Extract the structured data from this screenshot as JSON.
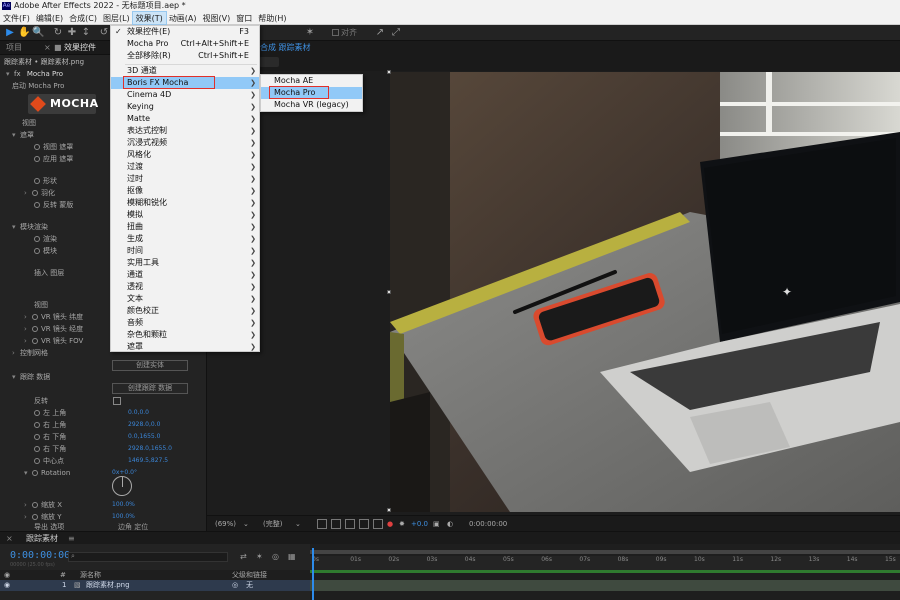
{
  "app": {
    "title": "Adobe After Effects 2022 - 无标题项目.aep *",
    "logo_text": "Ae"
  },
  "menubar": [
    "文件(F)",
    "编辑(E)",
    "合成(C)",
    "图层(L)",
    "效果(T)",
    "动画(A)",
    "视图(V)",
    "窗口",
    "帮助(H)"
  ],
  "toolbar": {
    "snap_label": "对齐"
  },
  "left_panel": {
    "tabs": [
      "项目",
      "效果控件"
    ],
    "crumb": "跟踪素材 • 跟踪素材.png",
    "effect_name": "Mocha Pro",
    "mocha_logo_text": "MOCHA",
    "rows": [
      {
        "label": "启动  Mocha Pro",
        "indent": 1
      },
      {
        "label": "视图",
        "indent": 1
      },
      {
        "label": "遮罩",
        "indent": 1
      },
      {
        "label": "视图 遮罩",
        "indent": 3
      },
      {
        "label": "应用 遮罩",
        "indent": 3
      },
      {
        "label": "形状",
        "indent": 3
      },
      {
        "label": "羽化",
        "indent": 3
      },
      {
        "label": "反转 蒙版",
        "indent": 3
      },
      {
        "label": "模块渲染",
        "indent": 1
      },
      {
        "label": "渲染",
        "indent": 3
      },
      {
        "label": "模块",
        "indent": 3
      },
      {
        "label": "插入 图层",
        "indent": 2
      },
      {
        "label": "视图",
        "indent": 2
      },
      {
        "label": "VR 镜头 纬度",
        "indent": 3
      },
      {
        "label": "VR 镜头 经度",
        "indent": 3
      },
      {
        "label": "VR 镜头 FOV",
        "indent": 3
      },
      {
        "label": "控制网格",
        "indent": 1
      },
      {
        "label": "跟踪 数据",
        "indent": 1
      },
      {
        "label": "反转",
        "indent": 2
      },
      {
        "label": "左 上角",
        "indent": 3
      },
      {
        "label": "右 上角",
        "indent": 3
      },
      {
        "label": "右 下角",
        "indent": 3
      },
      {
        "label": "右 下角",
        "indent": 3
      },
      {
        "label": "中心点",
        "indent": 3
      },
      {
        "label": "Rotation",
        "indent": 3
      },
      {
        "label": "缩放 X",
        "indent": 3
      },
      {
        "label": "缩放 Y",
        "indent": 3
      },
      {
        "label": "导出 选项",
        "indent": 2
      }
    ],
    "buttons": {
      "create_solid": "创建实体",
      "create_track": "创建跟踪 数据"
    },
    "values": [
      "0.0,0.0",
      "2928.0,0.0",
      "0.0,1655.0",
      "2928.0,1655.0",
      "1469.5,827.5",
      "0x+0.0°",
      "100.0%",
      "100.0%"
    ],
    "export_value": "边角 定位"
  },
  "comp": {
    "tab": "合成 跟踪素材",
    "zoom": "(69%)",
    "quality": "(完整)",
    "exposure": "+0.0",
    "timecode": "0:00:00:00"
  },
  "effects_menu": {
    "items": [
      {
        "label": "效果控件(E)",
        "shortcut": "F3",
        "checked": true
      },
      {
        "label": "Mocha Pro",
        "shortcut": "Ctrl+Alt+Shift+E"
      },
      {
        "label": "全部移除(R)",
        "shortcut": "Ctrl+Shift+E"
      },
      {
        "label": "3D 通道",
        "submenu": true
      },
      {
        "label": "Boris FX Mocha",
        "submenu": true,
        "highlight": true
      },
      {
        "label": "Cinema 4D",
        "submenu": true
      },
      {
        "label": "Keying",
        "submenu": true
      },
      {
        "label": "Matte",
        "submenu": true
      },
      {
        "label": "表达式控制",
        "submenu": true
      },
      {
        "label": "沉浸式视频",
        "submenu": true
      },
      {
        "label": "风格化",
        "submenu": true
      },
      {
        "label": "过渡",
        "submenu": true
      },
      {
        "label": "过时",
        "submenu": true
      },
      {
        "label": "抠像",
        "submenu": true
      },
      {
        "label": "模糊和锐化",
        "submenu": true
      },
      {
        "label": "模拟",
        "submenu": true
      },
      {
        "label": "扭曲",
        "submenu": true
      },
      {
        "label": "生成",
        "submenu": true
      },
      {
        "label": "时间",
        "submenu": true
      },
      {
        "label": "实用工具",
        "submenu": true
      },
      {
        "label": "通道",
        "submenu": true
      },
      {
        "label": "透视",
        "submenu": true
      },
      {
        "label": "文本",
        "submenu": true
      },
      {
        "label": "颜色校正",
        "submenu": true
      },
      {
        "label": "音频",
        "submenu": true
      },
      {
        "label": "杂色和颗粒",
        "submenu": true
      },
      {
        "label": "遮罩",
        "submenu": true
      }
    ]
  },
  "mocha_submenu": {
    "items": [
      {
        "label": "Mocha AE"
      },
      {
        "label": "Mocha Pro",
        "highlight": true
      },
      {
        "label": "Mocha VR (legacy)"
      }
    ]
  },
  "timeline": {
    "tab": "跟踪素材",
    "timecode": "0:00:00:00",
    "fps": "00000 (25.00 fps)",
    "headers": [
      "#",
      "源名称",
      "父级和链接"
    ],
    "layer": {
      "index": "1",
      "name": "跟踪素材.png",
      "parent": "无"
    },
    "ruler": [
      "0s",
      "01s",
      "02s",
      "03s",
      "04s",
      "05s",
      "06s",
      "07s",
      "08s",
      "09s",
      "10s",
      "11s",
      "12s",
      "13s",
      "14s",
      "15s"
    ]
  },
  "colors": {
    "accent": "#2d8ceb",
    "menu_highlight": "#91c9f7",
    "annotation_red": "#e0302a"
  }
}
